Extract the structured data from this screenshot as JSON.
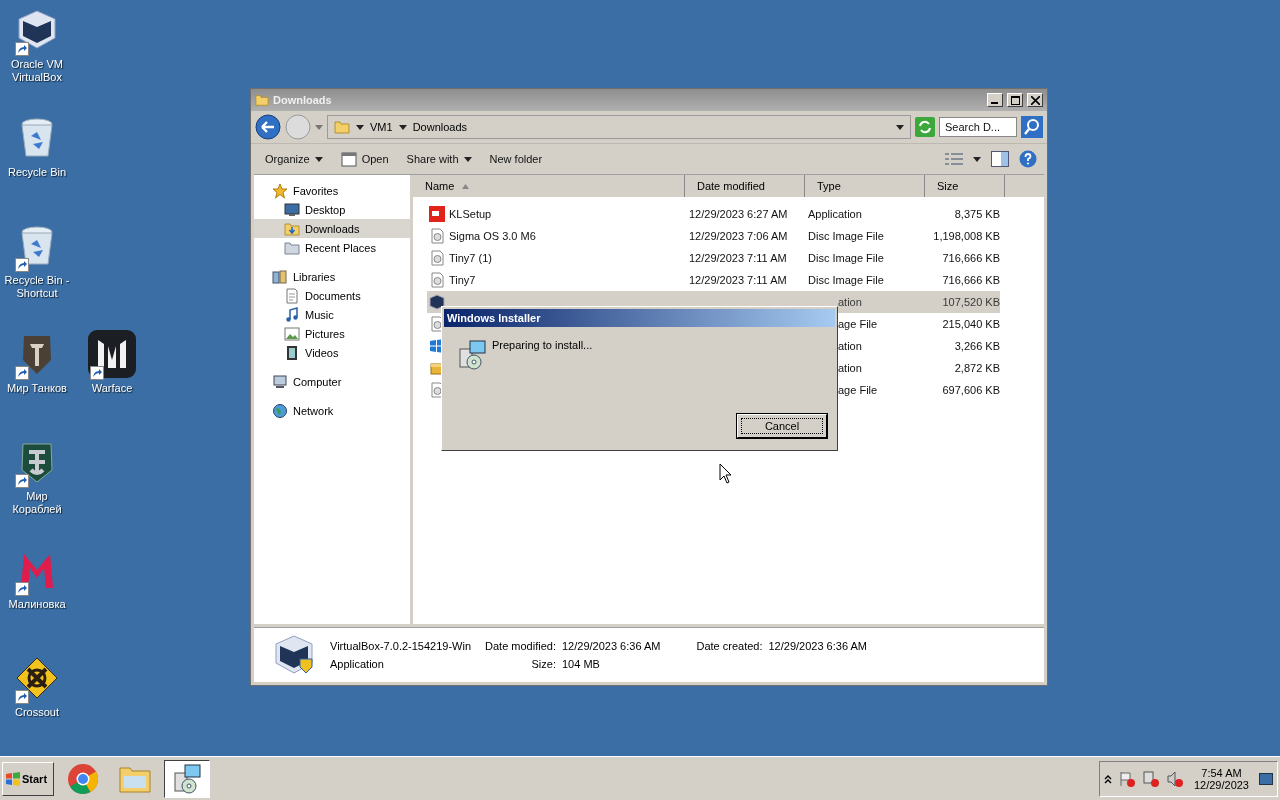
{
  "desktop_icons": [
    {
      "label": "Oracle VM\nVirtualBox",
      "kind": "vbox",
      "shortcut": true
    },
    {
      "label": "Recycle Bin",
      "kind": "bin",
      "shortcut": false
    },
    {
      "label": "Recycle Bin -\nShortcut",
      "kind": "bin",
      "shortcut": true
    },
    {
      "label": "Мир Танков",
      "kind": "tanks",
      "shortcut": true
    },
    {
      "label": "Warface",
      "kind": "warface",
      "shortcut": true
    },
    {
      "label": "Мир\nКораблей",
      "kind": "ships",
      "shortcut": true
    },
    {
      "label": "Малиновка",
      "kind": "malina",
      "shortcut": true
    },
    {
      "label": "Crossout",
      "kind": "crossout",
      "shortcut": true
    }
  ],
  "explorer": {
    "title": "Downloads",
    "address": [
      "VM1",
      "Downloads"
    ],
    "search": {
      "placeholder": "Search D..."
    },
    "toolbar": [
      {
        "label": "Organize",
        "kind": "menu"
      },
      {
        "label": "Open",
        "kind": "open"
      },
      {
        "label": "Share with",
        "kind": "menu"
      },
      {
        "label": "New folder",
        "kind": "plain"
      }
    ],
    "nav": [
      {
        "label": "Favorites",
        "kind": "star",
        "selected": false,
        "children": [
          {
            "label": "Desktop",
            "kind": "desktop",
            "selected": false
          },
          {
            "label": "Downloads",
            "kind": "folder",
            "selected": true
          },
          {
            "label": "Recent Places",
            "kind": "recent",
            "selected": false
          }
        ]
      },
      {
        "label": "Libraries",
        "kind": "library",
        "selected": false,
        "children": [
          {
            "label": "Documents",
            "kind": "doc",
            "selected": false
          },
          {
            "label": "Music",
            "kind": "music",
            "selected": false
          },
          {
            "label": "Pictures",
            "kind": "pictures",
            "selected": false
          },
          {
            "label": "Videos",
            "kind": "videos",
            "selected": false
          }
        ]
      },
      {
        "label": "Computer",
        "kind": "computer",
        "selected": false
      },
      {
        "label": "Network",
        "kind": "network",
        "selected": false
      }
    ],
    "columns": [
      "Name",
      "Date modified",
      "Type",
      "Size"
    ],
    "rows": [
      {
        "name": "KLSetup",
        "date": "12/29/2023 6:27 AM",
        "type": "Application",
        "size": "8,375 KB",
        "kind": "kl",
        "selected": false,
        "covered": false
      },
      {
        "name": "Sigma OS 3.0 M6",
        "date": "12/29/2023 7:06 AM",
        "type": "Disc Image File",
        "size": "1,198,008 KB",
        "kind": "disc",
        "selected": false,
        "covered": false
      },
      {
        "name": "Tiny7 (1)",
        "date": "12/29/2023 7:11 AM",
        "type": "Disc Image File",
        "size": "716,666 KB",
        "kind": "disc",
        "selected": false,
        "covered": false
      },
      {
        "name": "Tiny7",
        "date": "12/29/2023 7:11 AM",
        "type": "Disc Image File",
        "size": "716,666 KB",
        "kind": "disc",
        "selected": false,
        "covered": false
      },
      {
        "type": "ation",
        "size": "107,520 KB",
        "kind": "vbox",
        "selected": true,
        "covered": true
      },
      {
        "type": "age File",
        "size": "215,040 KB",
        "kind": "disc",
        "selected": false,
        "covered": true
      },
      {
        "type": "ation",
        "size": "3,266 KB",
        "kind": "win",
        "selected": false,
        "covered": true
      },
      {
        "type": "ation",
        "size": "2,872 KB",
        "kind": "box",
        "selected": false,
        "covered": true
      },
      {
        "type": "age File",
        "size": "697,606 KB",
        "kind": "disc",
        "selected": false,
        "covered": true
      }
    ],
    "details": {
      "name": "VirtualBox-7.0.2-154219-Win",
      "type": "Application",
      "fields": [
        {
          "label": "Date modified:",
          "value": "12/29/2023 6:36 AM"
        },
        {
          "label": "Size:",
          "value": "104 MB"
        },
        {
          "label": "Date created:",
          "value": "12/29/2023 6:36 AM"
        }
      ]
    }
  },
  "dialog": {
    "title": "Windows Installer",
    "message": "Preparing to install...",
    "button": "Cancel"
  },
  "taskbar": {
    "start": "Start",
    "apps": [
      {
        "kind": "chrome",
        "selected": false
      },
      {
        "kind": "explorer",
        "selected": false
      },
      {
        "kind": "installer",
        "selected": true
      }
    ],
    "time": "7:54 AM",
    "date": "12/29/2023"
  }
}
